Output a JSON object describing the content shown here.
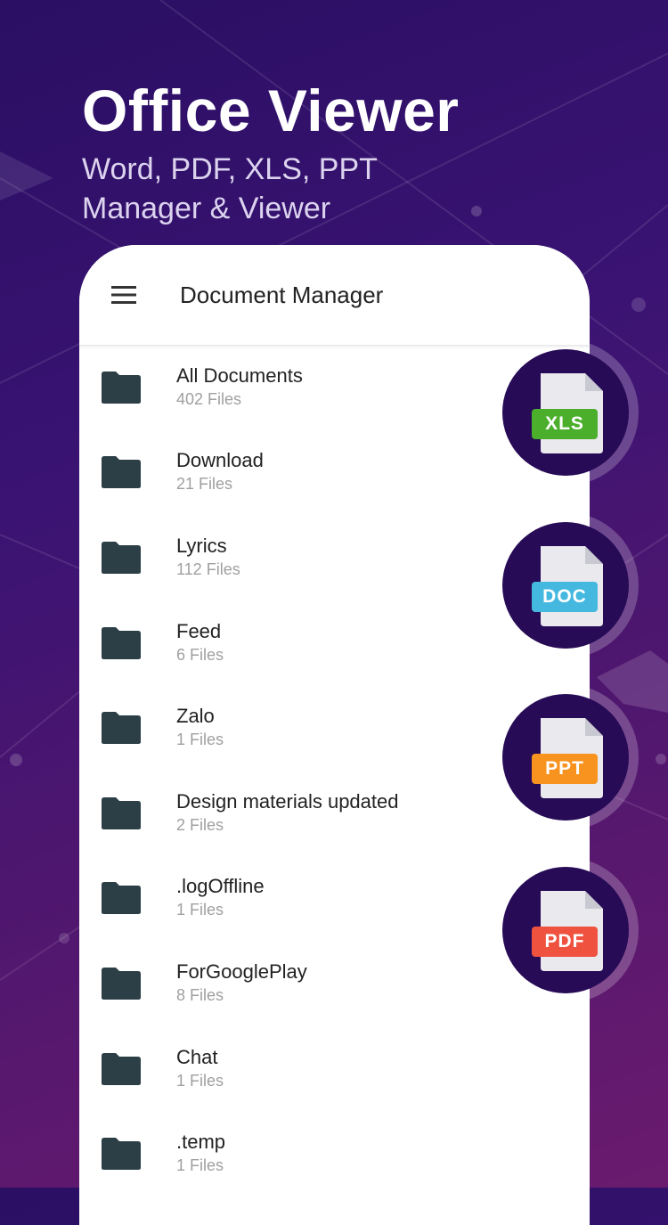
{
  "hero": {
    "title": "Office Viewer",
    "subtitle_line1": "Word, PDF, XLS, PPT",
    "subtitle_line2": "Manager & Viewer"
  },
  "appbar": {
    "menu_icon": "hamburger-menu-icon",
    "title": "Document Manager"
  },
  "folders": [
    {
      "name": "All Documents",
      "count": "402 Files"
    },
    {
      "name": "Download",
      "count": "21 Files"
    },
    {
      "name": "Lyrics",
      "count": "112 Files"
    },
    {
      "name": "Feed",
      "count": "6 Files"
    },
    {
      "name": "Zalo",
      "count": "1 Files"
    },
    {
      "name": "Design materials updated",
      "count": "2 Files"
    },
    {
      "name": ".logOffline",
      "count": "1 Files"
    },
    {
      "name": "ForGooglePlay",
      "count": "8 Files"
    },
    {
      "name": "Chat",
      "count": "1 Files"
    },
    {
      "name": ".temp",
      "count": "1 Files"
    }
  ],
  "file_badges": [
    {
      "label": "XLS",
      "color": "#4caf2c"
    },
    {
      "label": "DOC",
      "color": "#45b8e0"
    },
    {
      "label": "PPT",
      "color": "#f7931e"
    },
    {
      "label": "PDF",
      "color": "#ef5340"
    }
  ],
  "colors": {
    "folder_icon": "#2c3e46",
    "badge_circle": "#270b56"
  }
}
